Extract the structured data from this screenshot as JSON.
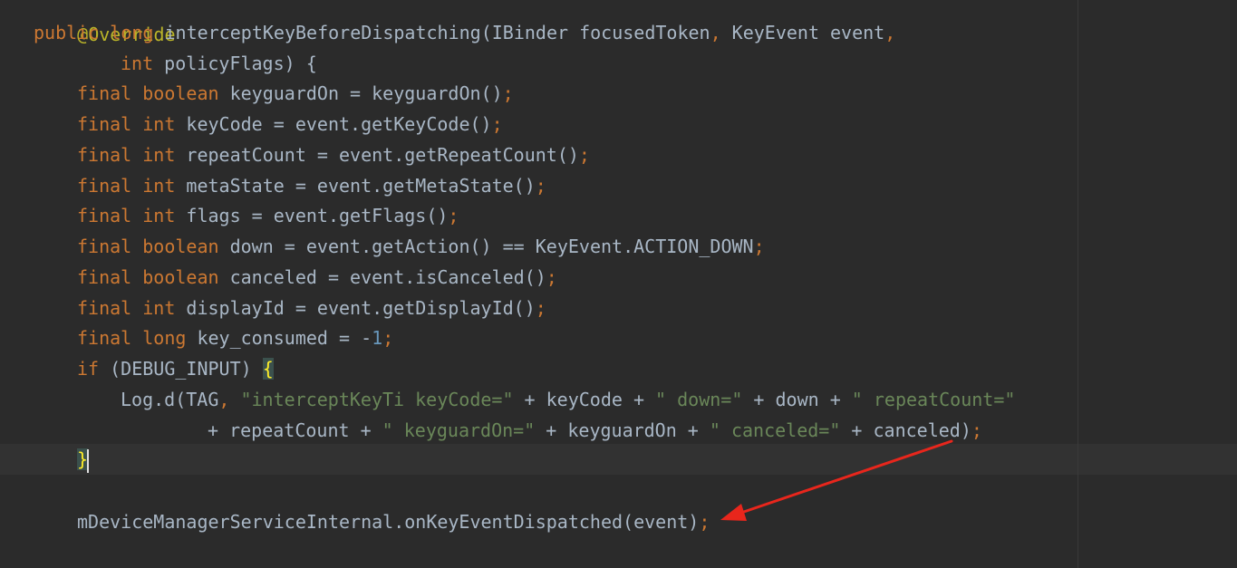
{
  "editor": {
    "indent": "    ",
    "lines": [
      {
        "annotation": "@Override"
      },
      {
        "kw1": "public",
        "kw2": "long",
        "text": " interceptKeyBeforeDispatching(IBinder focusedToken",
        "comma": ",",
        "text2": " KeyEvent event",
        "comma2": ","
      },
      {
        "kw1": "int",
        "text": " policyFlags) {"
      },
      {
        "kw1": "final",
        "kw2": "boolean",
        "text": " keyguardOn = keyguardOn()",
        "semi": ";"
      },
      {
        "kw1": "final",
        "kw2": "int",
        "text": " keyCode = event.getKeyCode()",
        "semi": ";"
      },
      {
        "kw1": "final",
        "kw2": "int",
        "text": " repeatCount = event.getRepeatCount()",
        "semi": ";"
      },
      {
        "kw1": "final",
        "kw2": "int",
        "text": " metaState = event.getMetaState()",
        "semi": ";"
      },
      {
        "kw1": "final",
        "kw2": "int",
        "text": " flags = event.getFlags()",
        "semi": ";"
      },
      {
        "kw1": "final",
        "kw2": "boolean",
        "text": " down = event.getAction() == KeyEvent.ACTION_DOWN",
        "semi": ";"
      },
      {
        "kw1": "final",
        "kw2": "boolean",
        "text": " canceled = event.isCanceled()",
        "semi": ";"
      },
      {
        "kw1": "final",
        "kw2": "int",
        "text": " displayId = event.getDisplayId()",
        "semi": ";"
      },
      {
        "kw1": "final",
        "kw2": "long",
        "text": " key_consumed = -",
        "num": "1",
        "semi": ";"
      },
      {
        "kw1": "if",
        "text": " (DEBUG_INPUT) ",
        "brace": "{"
      },
      {
        "text": "Log.d(TAG",
        "comma": ",",
        "str1": " \"interceptKeyTi keyCode=\"",
        "text2": " + keyCode + ",
        "str2": "\" down=\"",
        "text3": " + down + ",
        "str3": "\" repeatCount=\""
      },
      {
        "text": "+ repeatCount + ",
        "str1": "\" keyguardOn=\"",
        "text2": " + keyguardOn + ",
        "str2": "\" canceled=\"",
        "text3": " + canceled)",
        "semi": ";"
      },
      {
        "brace": "}"
      },
      {
        "text": ""
      },
      {
        "text": "mDeviceManagerServiceInternal.onKeyEventDispatched(event)",
        "semi": ";"
      }
    ]
  },
  "colors": {
    "background": "#2b2b2b",
    "keyword": "#cc7832",
    "annotation": "#bbb529",
    "string": "#6a8759",
    "number": "#6897bb",
    "text": "#a9b7c6",
    "arrow": "#e8261c"
  }
}
